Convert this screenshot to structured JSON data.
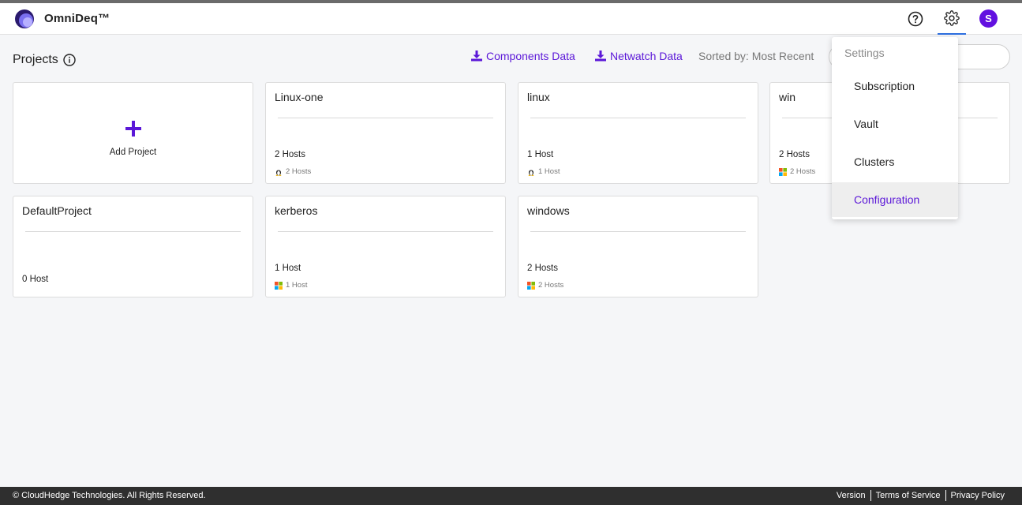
{
  "app": {
    "title": "OmniDeq™"
  },
  "page": {
    "title": "Projects"
  },
  "toolbar": {
    "components_data": "Components Data",
    "netwatch_data": "Netwatch Data",
    "sorted_by": "Sorted by: Most Recent"
  },
  "add_project": {
    "label": "Add Project"
  },
  "projects": [
    {
      "name": "Linux-one",
      "hosts": "2 Hosts",
      "os": "linux",
      "os_hosts": "2 Hosts"
    },
    {
      "name": "linux",
      "hosts": "1 Host",
      "os": "linux",
      "os_hosts": "1 Host"
    },
    {
      "name": "win",
      "hosts": "2 Hosts",
      "os": "windows",
      "os_hosts": "2 Hosts"
    },
    {
      "name": "DefaultProject",
      "hosts": "0 Host"
    },
    {
      "name": "kerberos",
      "hosts": "1 Host",
      "os": "windows",
      "os_hosts": "1 Host"
    },
    {
      "name": "windows",
      "hosts": "2 Hosts",
      "os": "windows",
      "os_hosts": "2 Hosts"
    }
  ],
  "user": {
    "initial": "S"
  },
  "settings_menu": {
    "title": "Settings",
    "items": [
      "Subscription",
      "Vault",
      "Clusters",
      "Configuration"
    ],
    "active": "Configuration"
  },
  "footer": {
    "copyright": "© CloudHedge Technologies. All Rights Reserved.",
    "links": [
      "Version",
      "Terms of Service",
      "Privacy Policy"
    ]
  },
  "colors": {
    "accent": "#5b17d8",
    "avatar": "#6210e0",
    "footer_bg": "#2f2f2f"
  },
  "icons": {
    "logo": "omnideq-logo-icon",
    "help": "help-circle-icon",
    "settings": "gear-icon",
    "info": "info-circle-icon",
    "download": "download-icon",
    "add": "plus-icon",
    "linux": "linux-tux-icon",
    "windows": "windows-logo-icon"
  }
}
